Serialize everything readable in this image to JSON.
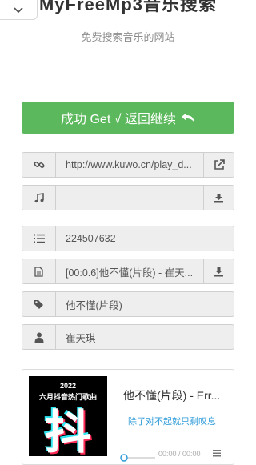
{
  "header": {
    "title": "MyFreeMp3音乐搜索",
    "subtitle": "免费搜索音乐的网站"
  },
  "success_button": {
    "label": "成功 Get √ 返回继续"
  },
  "rows": {
    "link": {
      "value": "http://www.kuwo.cn/play_d..."
    },
    "music": {
      "value": ""
    },
    "id": {
      "value": "224507632"
    },
    "lyrics": {
      "value": "[00:0.6]他不懂(片段) - 崔天..."
    },
    "tag": {
      "value": "他不懂(片段)"
    },
    "artist": {
      "value": "崔天琪"
    }
  },
  "player": {
    "cover": {
      "year": "2022",
      "caption": "六月抖音热门歌曲",
      "glyph": "抖"
    },
    "title": "他不懂(片段) - Err...",
    "lyric_line": "除了对不起就只剩叹息",
    "time": "00:00 / 00:00",
    "progress": 0
  },
  "icons": [
    "chevron-down-icon",
    "link-icon",
    "music-icon",
    "list-icon",
    "file-icon",
    "tag-icon",
    "user-icon",
    "external-link-icon",
    "download-icon",
    "reply-icon",
    "menu-icon"
  ],
  "colors": {
    "success": "#5cb85c",
    "lyric": "#2e9bd8",
    "addon_bg": "#eeeeee"
  }
}
